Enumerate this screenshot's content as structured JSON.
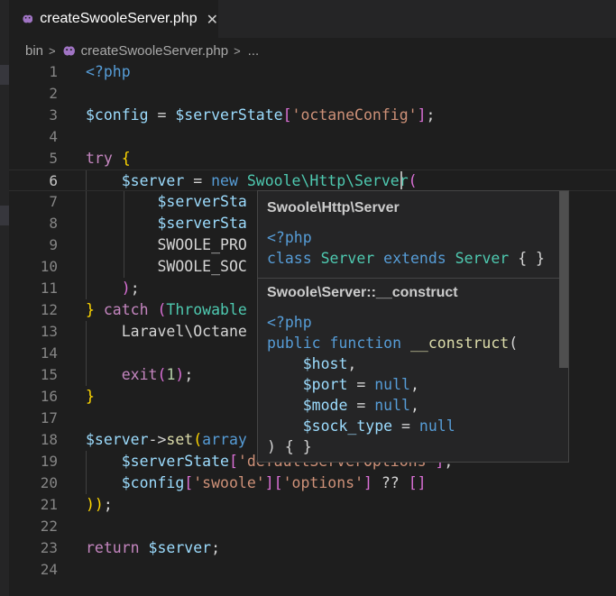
{
  "tab": {
    "filename": "createSwooleServer.php",
    "close_glyph": "✕"
  },
  "breadcrumb": {
    "folder": "bin",
    "file": "createSwooleServer.php",
    "more": "..."
  },
  "colors": {
    "php_icon": "#a074c4",
    "background": "#1e1e1e"
  },
  "editor": {
    "line_numbers": [
      "1",
      "2",
      "3",
      "4",
      "5",
      "6",
      "7",
      "8",
      "9",
      "10",
      "11",
      "12",
      "13",
      "14",
      "15",
      "16",
      "17",
      "18",
      "19",
      "20",
      "21",
      "22",
      "23",
      "24"
    ],
    "active_line": "6",
    "lines": [
      [
        [
          "<?php",
          "kb"
        ]
      ],
      [],
      [
        [
          "$config",
          "v"
        ],
        [
          " = ",
          "p"
        ],
        [
          "$serverState",
          "v"
        ],
        [
          "[",
          "bp"
        ],
        [
          "'octaneConfig'",
          "s"
        ],
        [
          "]",
          "bp"
        ],
        [
          ";",
          "p"
        ]
      ],
      [],
      [
        [
          "try",
          "k"
        ],
        [
          " ",
          "p"
        ],
        [
          "{",
          "by"
        ]
      ],
      [
        [
          "    ",
          "p"
        ],
        [
          "$server",
          "v"
        ],
        [
          " = ",
          "p"
        ],
        [
          "new",
          "kb"
        ],
        [
          " Swoole\\Http\\Server",
          "t"
        ],
        [
          "(",
          "bp"
        ]
      ],
      [
        [
          "        ",
          "p"
        ],
        [
          "$serverSta",
          "v"
        ]
      ],
      [
        [
          "        ",
          "p"
        ],
        [
          "$serverSta",
          "v"
        ]
      ],
      [
        [
          "        ",
          "p"
        ],
        [
          "SWOOLE_PRO",
          "p"
        ]
      ],
      [
        [
          "        ",
          "p"
        ],
        [
          "SWOOLE_SOC",
          "p"
        ]
      ],
      [
        [
          "    ",
          "p"
        ],
        [
          ")",
          "bp"
        ],
        [
          ";",
          "p"
        ]
      ],
      [
        [
          "}",
          "by"
        ],
        [
          " ",
          "p"
        ],
        [
          "catch",
          "k"
        ],
        [
          " ",
          "p"
        ],
        [
          "(",
          "bp"
        ],
        [
          "Throwable",
          "t"
        ]
      ],
      [
        [
          "    ",
          "p"
        ],
        [
          "Laravel\\Octane",
          "p"
        ]
      ],
      [],
      [
        [
          "    ",
          "p"
        ],
        [
          "exit",
          "k"
        ],
        [
          "(",
          "bp"
        ],
        [
          "1",
          "n"
        ],
        [
          ")",
          "bp"
        ],
        [
          ";",
          "p"
        ]
      ],
      [
        [
          "}",
          "by"
        ]
      ],
      [],
      [
        [
          "$server",
          "v"
        ],
        [
          "->",
          "p"
        ],
        [
          "set",
          "f"
        ],
        [
          "(",
          "by"
        ],
        [
          "array",
          "kb"
        ]
      ],
      [
        [
          "    ",
          "p"
        ],
        [
          "$serverState",
          "v"
        ],
        [
          "[",
          "bp"
        ],
        [
          "'defaultServerOptions'",
          "s"
        ],
        [
          "]",
          "bp"
        ],
        [
          ",",
          "p"
        ]
      ],
      [
        [
          "    ",
          "p"
        ],
        [
          "$config",
          "v"
        ],
        [
          "[",
          "bp"
        ],
        [
          "'swoole'",
          "s"
        ],
        [
          "]",
          "bp"
        ],
        [
          "[",
          "bp"
        ],
        [
          "'options'",
          "s"
        ],
        [
          "]",
          "bp"
        ],
        [
          " ?? ",
          "p"
        ],
        [
          "[]",
          "bp"
        ]
      ],
      [
        [
          "))",
          "by"
        ],
        [
          ";",
          "p"
        ]
      ],
      [],
      [
        [
          "return",
          "k"
        ],
        [
          " ",
          "p"
        ],
        [
          "$server",
          "v"
        ],
        [
          ";",
          "p"
        ]
      ],
      []
    ]
  },
  "hover": {
    "class_title": "Swoole\\Http\\Server",
    "class_code": [
      [
        [
          "<?php",
          "kb"
        ]
      ],
      [
        [
          "class",
          "kb"
        ],
        [
          " Server ",
          "t"
        ],
        [
          "extends",
          "kb"
        ],
        [
          " Server ",
          "t"
        ],
        [
          "{ }",
          "p"
        ]
      ]
    ],
    "method_title": "Swoole\\Server::__construct",
    "method_code": [
      [
        [
          "<?php",
          "kb"
        ]
      ],
      [
        [
          "public",
          "kb"
        ],
        [
          " ",
          "p"
        ],
        [
          "function",
          "kb"
        ],
        [
          " __construct",
          "f"
        ],
        [
          "(",
          "p"
        ]
      ],
      [
        [
          "    ",
          "p"
        ],
        [
          "$host",
          "v"
        ],
        [
          ",",
          "p"
        ]
      ],
      [
        [
          "    ",
          "p"
        ],
        [
          "$port",
          "v"
        ],
        [
          " = ",
          "p"
        ],
        [
          "null",
          "kb"
        ],
        [
          ",",
          "p"
        ]
      ],
      [
        [
          "    ",
          "p"
        ],
        [
          "$mode",
          "v"
        ],
        [
          " = ",
          "p"
        ],
        [
          "null",
          "kb"
        ],
        [
          ",",
          "p"
        ]
      ],
      [
        [
          "    ",
          "p"
        ],
        [
          "$sock_type",
          "v"
        ],
        [
          " = ",
          "p"
        ],
        [
          "null",
          "kb"
        ]
      ],
      [
        [
          ") { }",
          "p"
        ]
      ]
    ]
  }
}
